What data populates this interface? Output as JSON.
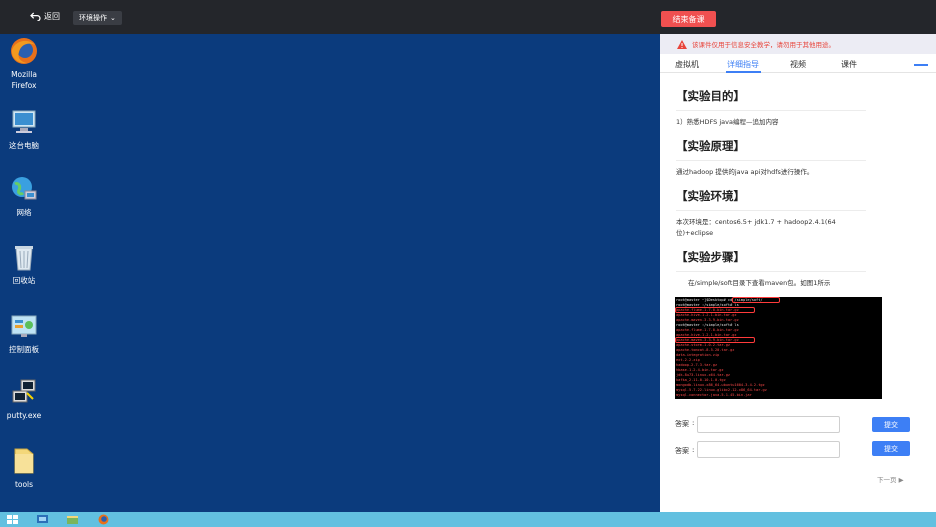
{
  "topbar": {
    "back_label": "返回",
    "env_label": "环境操作",
    "end_label": "结束备课"
  },
  "desktop": {
    "icons": [
      {
        "label_line1": "Mozilla",
        "label_line2": "Firefox",
        "icon": "firefox-icon"
      },
      {
        "label_line1": "这台电脑",
        "label_line2": "",
        "icon": "computer-icon"
      },
      {
        "label_line1": "网络",
        "label_line2": "",
        "icon": "network-icon"
      },
      {
        "label_line1": "回收站",
        "label_line2": "",
        "icon": "recycle-bin-icon"
      },
      {
        "label_line1": "控制面板",
        "label_line2": "",
        "icon": "control-panel-icon"
      },
      {
        "label_line1": "putty.exe",
        "label_line2": "",
        "icon": "putty-icon"
      },
      {
        "label_line1": "tools",
        "label_line2": "",
        "icon": "folder-icon"
      }
    ]
  },
  "panel": {
    "warning": "该课件仅用于信息安全教学，请勿用于其他用途。",
    "tabs": [
      "虚拟机",
      "详细指导",
      "视频",
      "课件"
    ],
    "active_tab": "详细指导",
    "sections": [
      {
        "heading": "【实验目的】",
        "text": "1）熟悉HDFS java编程—追加内容"
      },
      {
        "heading": "【实验原理】",
        "text": "通过hadoop 提供的java api对hdfs进行操作。"
      },
      {
        "heading": "【实验环境】",
        "text": "本次环境是：centos6.5+ jdk1.7 + hadoop2.4.1(64位)+eclipse"
      },
      {
        "heading": "【实验步骤】",
        "text": "在/simple/soft目录下查看maven包。如图1所示"
      }
    ],
    "terminal_lines": [
      "root@master ~]$Desktop# cd /simple/soft/",
      "root@master :/simple/soft# ls",
      "apache-flume-1.7.0-bin.tar.gz",
      "apache-hive-1.2.1-bin.tar.gz",
      "apache-maven-3.3.9-bin.tar.gz",
      "root@master :/simple/soft# ls",
      "apache-flume-1.7.0-bin.tar.gz",
      "apache-hive-1.2.1-bin.tar.gz",
      "apache-maven-3.3.9-bin.tar.gz",
      "apache-storm-1.0.2.tar.gz",
      "apache-tomcat-8.5.20.tar.gz",
      "data-integration.zip",
      "ext-2.2.zip",
      "hadoop-2.7.3.tar.gz",
      "hbase-1.2.4-bin.tar.gz",
      "jdk-8u73-linux-x64.tar.gz",
      "kafka_2.11-0.10.1.0.tgz",
      "mongodb-linux-x86_64-ubuntu1604-3.4.2.tgz",
      "mysql-5.7.22-linux-glibc2.12-x86_64.tar.gz",
      "mysql-connector-java-5.1.45-bin.jar"
    ],
    "answer_label": "答案",
    "submit_label": "提交",
    "next_label": "下一页 ▶"
  },
  "colors": {
    "accent": "#3d7ff5",
    "danger": "#f05050",
    "desktop_bg": "#0b3b7d",
    "taskbar": "#62c0e0"
  }
}
